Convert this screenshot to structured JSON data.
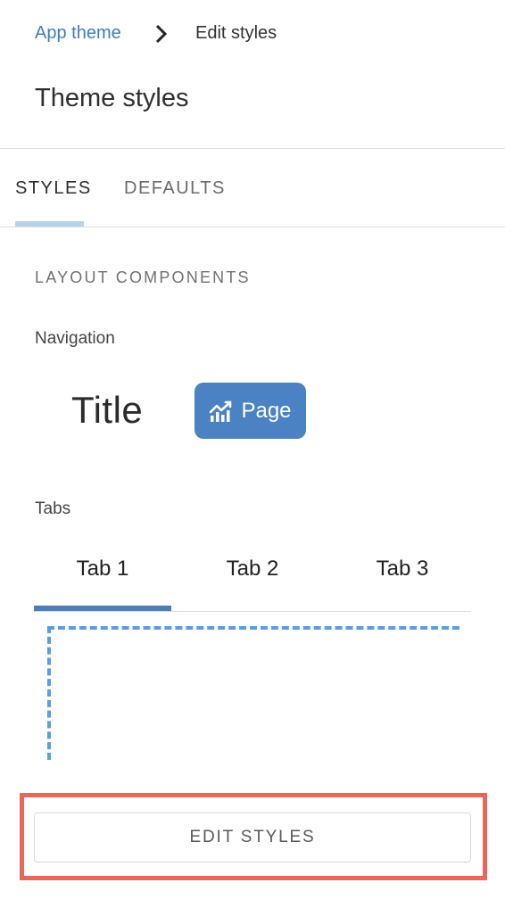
{
  "breadcrumb": {
    "parent": "App theme",
    "current": "Edit styles"
  },
  "page": {
    "title": "Theme styles"
  },
  "tabs": [
    {
      "label": "STYLES",
      "active": true
    },
    {
      "label": "DEFAULTS",
      "active": false
    }
  ],
  "section": {
    "heading": "LAYOUT COMPONENTS"
  },
  "navigation": {
    "label": "Navigation",
    "preview_title": "Title",
    "page_button_label": "Page",
    "page_button_icon": "chart-line-icon"
  },
  "tabs_preview": {
    "label": "Tabs",
    "items": [
      "Tab 1",
      "Tab 2",
      "Tab 3"
    ],
    "active_index": 0
  },
  "actions": {
    "edit_styles": "EDIT STYLES"
  },
  "colors": {
    "accent": "#4a82c3",
    "link": "#3f7db8",
    "highlight": "#e9665b",
    "dashed": "#5b9de0"
  }
}
